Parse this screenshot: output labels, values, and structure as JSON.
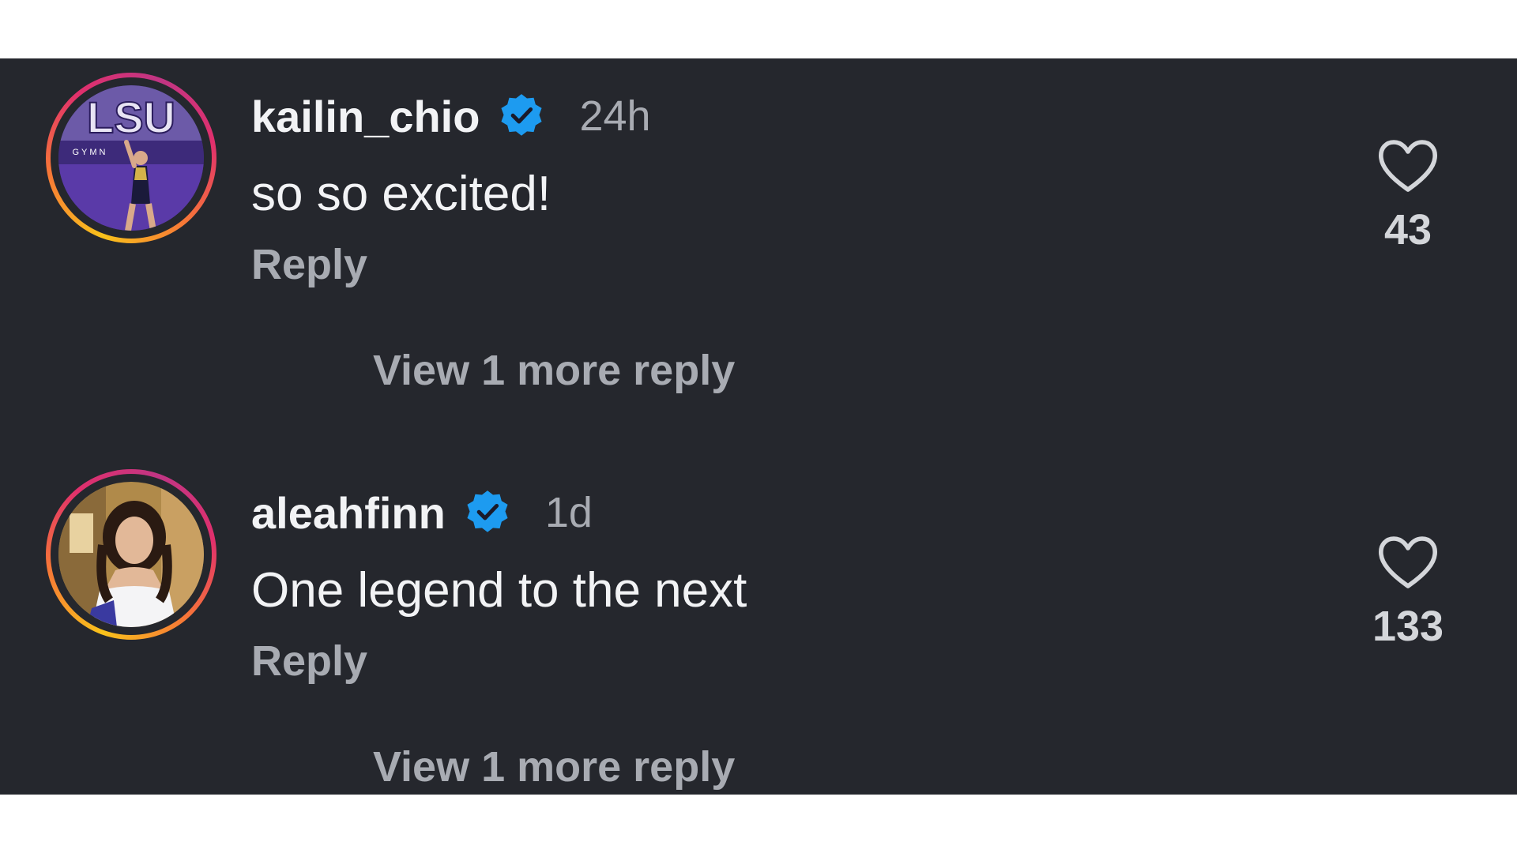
{
  "comments": [
    {
      "username": "kailin_chio",
      "time": "24h",
      "text": "so so excited!",
      "reply_label": "Reply",
      "likes": "43",
      "view_more": "View 1 more reply",
      "avatar_text": "LSU",
      "avatar_subtext": "GYMN",
      "verified_icon": "verified-badge-icon",
      "like_icon": "heart-outline-icon"
    },
    {
      "username": "aleahfinn",
      "time": "1d",
      "text": "One legend to the next",
      "reply_label": "Reply",
      "likes": "133",
      "view_more": "View 1 more reply",
      "verified_icon": "verified-badge-icon",
      "like_icon": "heart-outline-icon"
    }
  ],
  "colors": {
    "background": "#25272d",
    "primary_text": "#f2f3f5",
    "secondary_text": "#a8abb2",
    "verified_blue": "#1d9bf0",
    "story_ring": [
      "#f9c21b",
      "#f77737",
      "#e1306c",
      "#c13584"
    ]
  }
}
